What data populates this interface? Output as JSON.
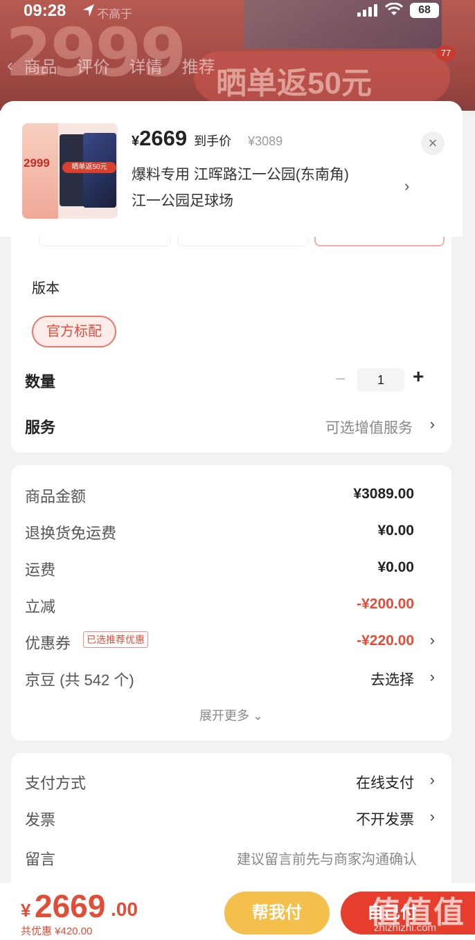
{
  "status": {
    "time": "09:28",
    "battery": "68"
  },
  "background": {
    "big_text": "2999",
    "not_over": "不高于",
    "tabs": [
      "商品",
      "评价",
      "详情",
      "推荐"
    ],
    "promo": "晒单返50元",
    "badge": "77"
  },
  "header": {
    "thumb_text": "2999",
    "thumb_pill": "晒单返50元",
    "price_yen": "¥",
    "price": "2669",
    "price_tag": "到手价",
    "orig_price": "¥3089",
    "address_line1": "爆料专用  江晖路江一公园(东南角)",
    "address_line2": "江一公园足球场"
  },
  "spec": {
    "version_label": "版本",
    "version_option": "官方标配",
    "qty_label": "数量",
    "qty_value": "1",
    "service_label": "服务",
    "service_value": "可选增值服务"
  },
  "summary": {
    "rows": [
      {
        "label": "商品金额",
        "value": "¥3089.00"
      },
      {
        "label": "退换货免运费",
        "value": "¥0.00"
      },
      {
        "label": "运费",
        "value": "¥0.00"
      },
      {
        "label": "立减",
        "value": "-¥200.00"
      },
      {
        "label": "优惠券",
        "value": "-¥220.00",
        "tag": "已选推荐优惠"
      },
      {
        "label": "京豆 (共 542 个)",
        "value": "去选择"
      }
    ],
    "more": "展开更多 ⌄"
  },
  "payment": {
    "method_label": "支付方式",
    "method_value": "在线支付",
    "invoice_label": "发票",
    "invoice_value": "不开发票",
    "message_label": "留言",
    "message_placeholder": "建议留言前先与商家沟通确认"
  },
  "bottom": {
    "yen": "¥",
    "price": "2669",
    "decimal": ".00",
    "saving": "共优惠 ¥420.00",
    "help_pay": "帮我付",
    "self_pay": "自己付"
  },
  "watermark": {
    "text": "值值值",
    "site": "zhizhizhi.com"
  },
  "colors": {
    "accent": "#e24d38",
    "help": "#f4bf4a",
    "pay": "#e63d2c"
  }
}
